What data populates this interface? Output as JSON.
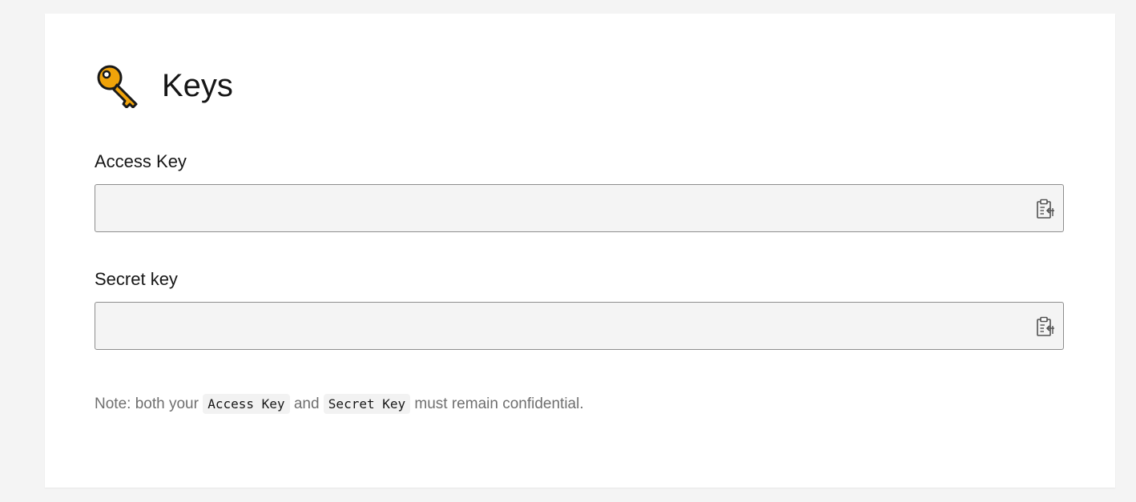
{
  "header": {
    "icon": "key-icon",
    "title": "Keys"
  },
  "fields": {
    "access_key": {
      "label": "Access Key",
      "value": "",
      "copy_icon": "clipboard-copy-icon"
    },
    "secret_key": {
      "label": "Secret key",
      "value": "",
      "copy_icon": "clipboard-copy-icon"
    }
  },
  "note": {
    "prefix": "Note: both your",
    "code1": "Access Key",
    "middle": "and",
    "code2": "Secret Key",
    "suffix": "must remain confidential."
  },
  "colors": {
    "key_icon": "#f0a30a",
    "field_background": "#f4f4f4",
    "field_border": "#8d8d8d"
  }
}
